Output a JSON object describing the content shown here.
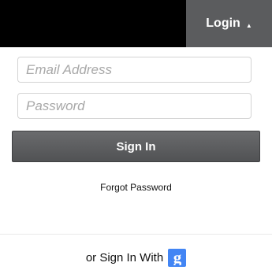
{
  "header": {
    "login_label": "Login",
    "caret": "▲"
  },
  "form": {
    "email": {
      "value": "",
      "placeholder": "Email Address"
    },
    "password": {
      "value": "",
      "placeholder": "Password"
    },
    "signin_label": "Sign In",
    "forgot_label": "Forgot Password"
  },
  "social": {
    "label": "or Sign In With",
    "google_icon": "google-icon"
  },
  "colors": {
    "topbar": "#000000",
    "login_tab": "#5b5c5e",
    "button": "#5a5b5d",
    "google": "#4285f4"
  }
}
